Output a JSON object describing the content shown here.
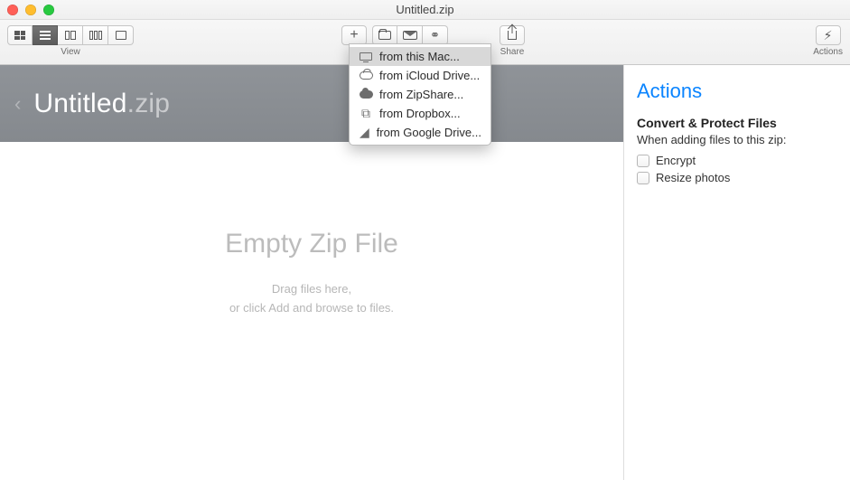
{
  "window_title": "Untitled.zip",
  "toolbar": {
    "view_label": "View",
    "share_label": "Share",
    "actions_label": "Actions"
  },
  "add_menu": {
    "items": [
      {
        "icon": "monitor",
        "label": "from this Mac..."
      },
      {
        "icon": "cloud-outline",
        "label": "from iCloud Drive..."
      },
      {
        "icon": "cloud-fill",
        "label": "from ZipShare..."
      },
      {
        "icon": "dropbox",
        "label": "from Dropbox..."
      },
      {
        "icon": "drive",
        "label": "from Google Drive..."
      }
    ],
    "highlighted_index": 0
  },
  "breadcrumb": {
    "name": "Untitled",
    "ext": ".zip"
  },
  "empty": {
    "heading": "Empty Zip File",
    "line1": "Drag files here,",
    "line2": "or click Add and browse to files."
  },
  "actions_pane": {
    "title": "Actions",
    "section_title": "Convert & Protect Files",
    "section_sub": "When adding files to this zip:",
    "options": [
      {
        "label": "Encrypt"
      },
      {
        "label": "Resize photos"
      }
    ]
  }
}
